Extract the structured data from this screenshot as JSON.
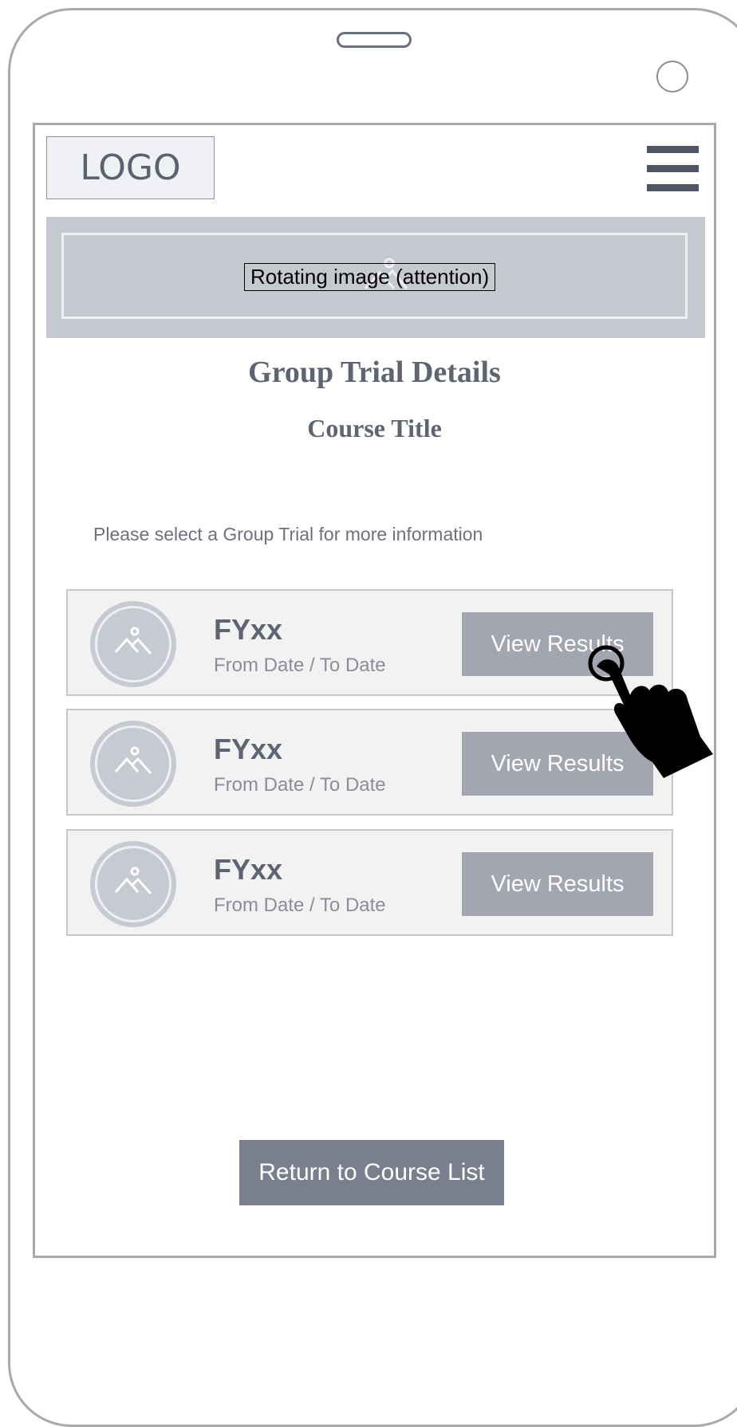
{
  "header": {
    "logo_text": "LOGO",
    "menu_icon": "hamburger-menu-icon"
  },
  "banner": {
    "label": "Rotating image (attention)",
    "icon": "image-placeholder-icon"
  },
  "page": {
    "title": "Group Trial Details",
    "course_title": "Course Title",
    "instruction": "Please select a Group Trial for more information"
  },
  "trials": [
    {
      "title": "FYxx",
      "dates": "From Date / To Date",
      "button_label": "View Results",
      "icon": "image-placeholder-icon"
    },
    {
      "title": "FYxx",
      "dates": "From Date / To Date",
      "button_label": "View Results",
      "icon": "image-placeholder-icon"
    },
    {
      "title": "FYxx",
      "dates": "From Date / To Date",
      "button_label": "View Results",
      "icon": "image-placeholder-icon"
    }
  ],
  "footer": {
    "return_label": "Return to Course List"
  },
  "annotation": {
    "icon": "pointing-hand-cursor-icon"
  },
  "colors": {
    "banner": "#c7c9d1",
    "card": "#f2f2f2",
    "view_button": "#a3a6b1",
    "return_button": "#7a7f90",
    "text": "#5f6472"
  }
}
